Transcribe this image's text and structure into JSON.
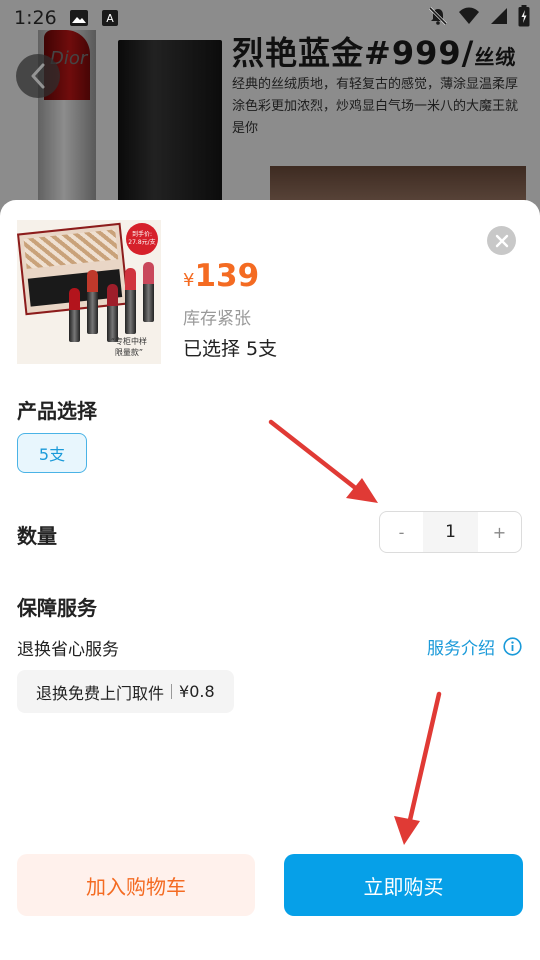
{
  "status_bar": {
    "time": "1:26",
    "icons": [
      "image-icon",
      "a-icon",
      "bell-off-icon",
      "wifi-icon",
      "signal-icon",
      "battery-charging-icon"
    ]
  },
  "background_page": {
    "banner_title": "烈艳蓝金#999/",
    "banner_title_suffix": "丝绒",
    "banner_desc": "经典的丝绒质地，有轻复古的感觉，薄涂显温柔厚涂色彩更加浓烈，炒鸡显白气场一米八的大魔王就是你",
    "watermark": "Dior"
  },
  "product": {
    "thumb_badge": [
      "到手价:",
      "27.8元/支"
    ],
    "thumb_note": [
      "“专柜中样",
      "限量款”"
    ],
    "currency": "¥",
    "price": "139",
    "stock": "库存紧张",
    "selected": "已选择 5支"
  },
  "spec": {
    "title": "产品选择",
    "options": [
      "5支"
    ],
    "selected_index": 0
  },
  "quantity": {
    "label": "数量",
    "minus": "-",
    "value": "1",
    "plus": "+"
  },
  "service": {
    "title": "保障服务",
    "subtitle": "退换省心服务",
    "link": "服务介绍",
    "chip_label": "退换免费上门取件",
    "chip_price": "¥0.8"
  },
  "actions": {
    "add_to_cart": "加入购物车",
    "buy_now": "立即购买"
  },
  "colors": {
    "accent": "#06a0e8",
    "price": "#f46b22",
    "cart_bg": "#fff1ec",
    "annotation_arrow": "#e03a35"
  }
}
